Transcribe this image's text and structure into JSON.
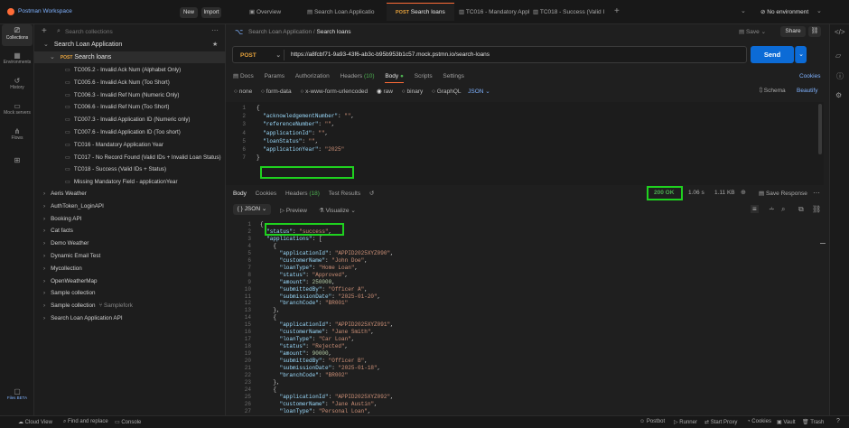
{
  "app": {
    "workspace": "Postman Workspace",
    "new_label": "New",
    "import_label": "Import",
    "environment": "No environment"
  },
  "tabs": [
    {
      "label": "Overview",
      "method": ""
    },
    {
      "label": "Search Loan Applicatio",
      "method": ""
    },
    {
      "label": "Search loans",
      "method": "POST"
    },
    {
      "label": "TC016 - Mandatory Appl",
      "method": ""
    },
    {
      "label": "TC018 - Success (Valid I",
      "method": ""
    }
  ],
  "rail": [
    "Collections",
    "Environments",
    "History",
    "Mock servers",
    "Flows",
    "",
    "Files BETA"
  ],
  "sidebar": {
    "search_placeholder": "Search collections",
    "root": "Search Loan Application",
    "request": {
      "method": "POST",
      "label": "Search loans"
    },
    "items": [
      "TC005.2 - Invalid Ack Num (Alphabet Only)",
      "TC005.6 - Invalid Ack Num (Too Short)",
      "TC006.3 - Invalid Ref Num (Numeric Only)",
      "TC006.6 - Invalid Ref Num (Too Short)",
      "TC007.3 - Invalid Application ID (Numeric only)",
      "TC007.6 - Invalid Application ID (Too short)",
      "TC016 - Mandatory Application Year",
      "TC017 - No Record Found (Valid IDs + Invalid Loan Status)",
      "TC018 - Success (Valid IDs + Status)",
      "Missing Mandatory Field - applicationYear"
    ],
    "collections": [
      "Aeris Weather",
      "AuthToken_LoginAPI",
      "Booking API",
      "Cat facts",
      "Demo Weather",
      "Dynamic Email Test",
      "Mycollection",
      "OpenWeatherMap",
      "Sample collection",
      "Sample collection",
      "Search Loan Application API"
    ],
    "fork_label": "Samplefork"
  },
  "request": {
    "breadcrumb_parent": "Search Loan Application",
    "breadcrumb_current": "Search loans",
    "save_label": "Save",
    "share_label": "Share",
    "method": "POST",
    "url": "https://a8fcbf71-9a93-43f6-ab3c-b95b953b1c57.mock.pstmn.io/search-loans",
    "send_label": "Send",
    "cookies_label": "Cookies",
    "subtabs": [
      "Docs",
      "Params",
      "Authorization",
      "Headers",
      "Body",
      "Scripts",
      "Settings"
    ],
    "headers_count": "(10)",
    "body_types": [
      "none",
      "form-data",
      "x-www-form-urlencoded",
      "raw",
      "binary",
      "GraphQL"
    ],
    "body_format": "JSON",
    "schema_label": "Schema",
    "beautify_label": "Beautify",
    "body_lines": [
      {
        "n": "1",
        "t": "{"
      },
      {
        "n": "2",
        "t": "  \"acknowledgementNumber\": \"\","
      },
      {
        "n": "3",
        "t": "  \"referenceNumber\": \"\","
      },
      {
        "n": "4",
        "t": "  \"applicationId\": \"\","
      },
      {
        "n": "5",
        "t": "  \"loanStatus\": \"\","
      },
      {
        "n": "6",
        "t": "  \"applicationYear\": \"2025\""
      },
      {
        "n": "7",
        "t": "}"
      }
    ]
  },
  "response": {
    "tabs": [
      "Body",
      "Cookies",
      "Headers",
      "Test Results"
    ],
    "headers_count": "(18)",
    "status": "200 OK",
    "time": "1.06 s",
    "size": "1.11 KB",
    "save_label": "Save Response",
    "format": "JSON",
    "preview_label": "Preview",
    "visualize_label": "Visualize",
    "lines": [
      {
        "n": "1",
        "t": "{"
      },
      {
        "n": "2",
        "t": "  \"status\": \"success\","
      },
      {
        "n": "3",
        "t": "  \"applications\": ["
      },
      {
        "n": "4",
        "t": "    {"
      },
      {
        "n": "5",
        "t": "      \"applicationId\": \"APPID2025XYZ090\","
      },
      {
        "n": "6",
        "t": "      \"customerName\": \"John Doe\","
      },
      {
        "n": "7",
        "t": "      \"loanType\": \"Home Loan\","
      },
      {
        "n": "8",
        "t": "      \"status\": \"Approved\","
      },
      {
        "n": "9",
        "t": "      \"amount\": 250000,"
      },
      {
        "n": "10",
        "t": "      \"submittedBy\": \"Officer A\","
      },
      {
        "n": "11",
        "t": "      \"submissionDate\": \"2025-01-20\","
      },
      {
        "n": "12",
        "t": "      \"branchCode\": \"BR001\""
      },
      {
        "n": "13",
        "t": "    },"
      },
      {
        "n": "14",
        "t": "    {"
      },
      {
        "n": "15",
        "t": "      \"applicationId\": \"APPID2025XYZ091\","
      },
      {
        "n": "16",
        "t": "      \"customerName\": \"Jane Smith\","
      },
      {
        "n": "17",
        "t": "      \"loanType\": \"Car Loan\","
      },
      {
        "n": "18",
        "t": "      \"status\": \"Rejected\","
      },
      {
        "n": "19",
        "t": "      \"amount\": 90000,"
      },
      {
        "n": "20",
        "t": "      \"submittedBy\": \"Officer B\","
      },
      {
        "n": "21",
        "t": "      \"submissionDate\": \"2025-01-18\","
      },
      {
        "n": "22",
        "t": "      \"branchCode\": \"BR002\""
      },
      {
        "n": "23",
        "t": "    },"
      },
      {
        "n": "24",
        "t": "    {"
      },
      {
        "n": "25",
        "t": "      \"applicationId\": \"APPID2025XYZ092\","
      },
      {
        "n": "26",
        "t": "      \"customerName\": \"Jane Austin\","
      },
      {
        "n": "27",
        "t": "      \"loanType\": \"Personal Loan\","
      },
      {
        "n": "28",
        "t": "      \"status\": \"Pending\","
      }
    ]
  },
  "statusbar": {
    "left": [
      "Cloud View",
      "Find and replace",
      "Console"
    ],
    "right": [
      "Postbot",
      "Runner",
      "Start Proxy",
      "Cookies",
      "Vault",
      "Trash"
    ]
  },
  "colors": {
    "accent": "#ff6c37",
    "send": "#0c6bd6",
    "highlight": "#1fd11f",
    "post": "#e6a23c"
  }
}
